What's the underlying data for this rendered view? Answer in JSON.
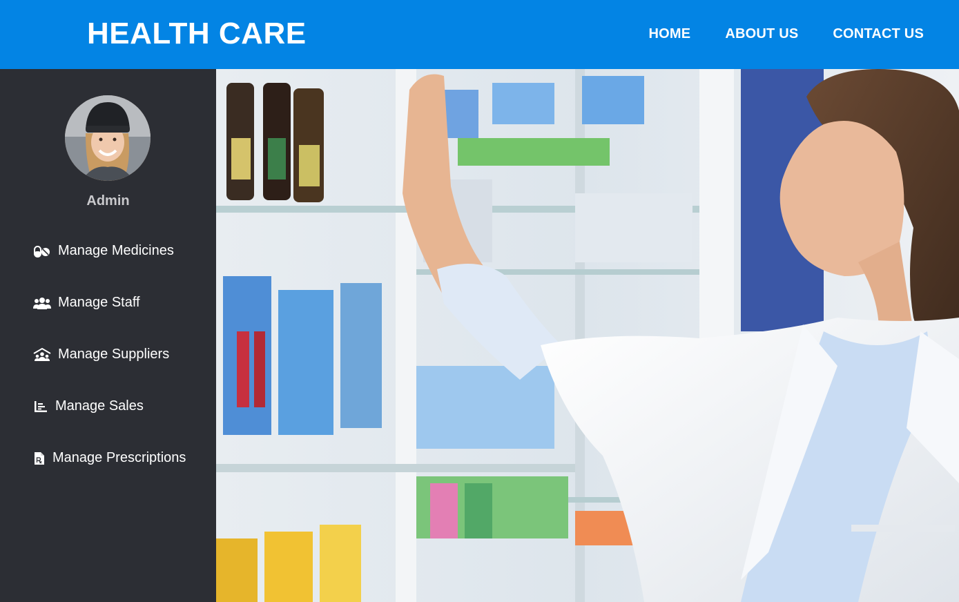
{
  "header": {
    "brand": "HEALTH CARE",
    "nav": [
      {
        "label": "HOME"
      },
      {
        "label": "ABOUT US"
      },
      {
        "label": "CONTACT US"
      }
    ]
  },
  "sidebar": {
    "user_role": "Admin",
    "items": [
      {
        "label": "Manage Medicines",
        "icon": "pills-icon"
      },
      {
        "label": "Manage Staff",
        "icon": "users-icon"
      },
      {
        "label": "Manage Suppliers",
        "icon": "supplier-icon"
      },
      {
        "label": "Manage Sales",
        "icon": "list-chart-icon"
      },
      {
        "label": "Manage Prescriptions",
        "icon": "prescription-icon"
      }
    ]
  },
  "colors": {
    "header_bg": "#0384e4",
    "sidebar_bg": "#2c2e34",
    "text_light": "#ffffff",
    "role_text": "#c9c9cc"
  }
}
